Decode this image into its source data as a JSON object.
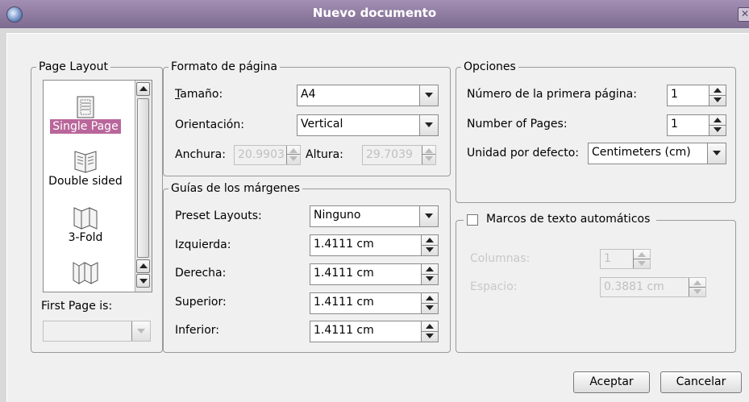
{
  "window": {
    "title": "Nuevo documento"
  },
  "page_layout": {
    "legend": "Page Layout",
    "items": [
      {
        "label": "Single Page",
        "icon": "single-page-icon"
      },
      {
        "label": "Double sided",
        "icon": "double-sided-icon"
      },
      {
        "label": "3-Fold",
        "icon": "three-fold-icon"
      },
      {
        "label": "",
        "icon": "four-fold-icon"
      }
    ],
    "selected": "Single Page",
    "first_page_label": "First Page is:",
    "first_page_value": ""
  },
  "formato": {
    "legend": "Formato de página",
    "tamano_label": "Tamaño:",
    "tamano_value": "A4",
    "orientacion_label": "Orientación:",
    "orientacion_value": "Vertical",
    "anchura_label": "Anchura:",
    "anchura_value": "20.9903",
    "altura_label": "Altura:",
    "altura_value": "29.7039"
  },
  "guias": {
    "legend": "Guías de los márgenes",
    "preset_label": "Preset Layouts:",
    "preset_value": "Ninguno",
    "izquierda_label": "Izquierda:",
    "izquierda_value": "1.4111 cm",
    "derecha_label": "Derecha:",
    "derecha_value": "1.4111 cm",
    "superior_label": "Superior:",
    "superior_value": "1.4111 cm",
    "inferior_label": "Inferior:",
    "inferior_value": "1.4111 cm"
  },
  "opciones": {
    "legend": "Opciones",
    "primera_label": "Número de la primera página:",
    "primera_value": "1",
    "pages_label": "Number of Pages:",
    "pages_value": "1",
    "unidad_label": "Unidad por defecto:",
    "unidad_value": "Centimeters (cm)"
  },
  "marcos": {
    "legend": "Marcos de texto automáticos",
    "checked": false,
    "columnas_label": "Columnas:",
    "columnas_value": "1",
    "espacio_label": "Espacio:",
    "espacio_value": "0.3881 cm"
  },
  "buttons": {
    "aceptar": "Aceptar",
    "cancelar": "Cancelar"
  },
  "colors": {
    "selection": "#b9669b",
    "titlebar": "#8f7ba3"
  }
}
